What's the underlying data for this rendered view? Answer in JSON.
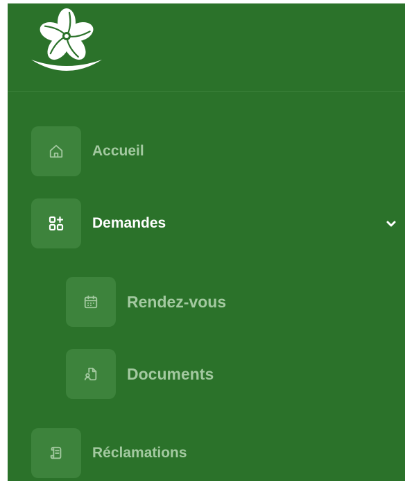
{
  "sidebar": {
    "logo_icon": "flower-logo-icon",
    "items": [
      {
        "label": "Accueil",
        "icon": "home-icon"
      },
      {
        "label": "Demandes",
        "icon": "apps-add-icon",
        "expanded": true
      },
      {
        "label": "Rendez-vous",
        "icon": "calendar-icon"
      },
      {
        "label": "Documents",
        "icon": "document-user-icon"
      },
      {
        "label": "Réclamations",
        "icon": "scroll-icon"
      }
    ],
    "chevron_icon": "chevron-down-icon"
  },
  "colors": {
    "sidebar_bg": "#2b722a",
    "icon_box_bg": "#3d833c",
    "inactive_text": "#a3c9a0",
    "active_text": "#ffffff"
  }
}
